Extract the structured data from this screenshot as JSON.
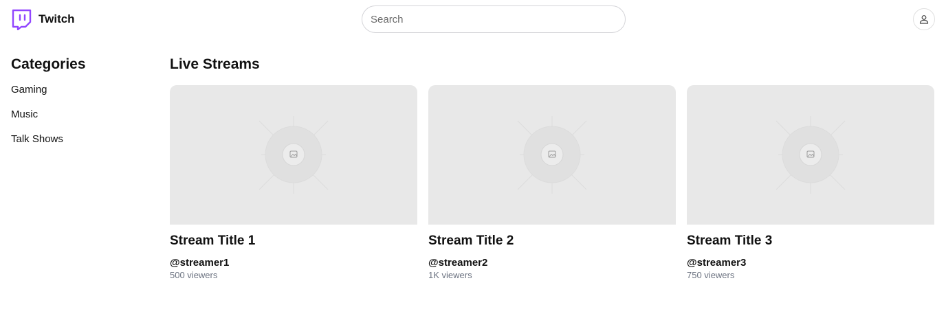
{
  "header": {
    "brand": "Twitch",
    "search_placeholder": "Search"
  },
  "sidebar": {
    "title": "Categories",
    "items": [
      {
        "label": "Gaming"
      },
      {
        "label": "Music"
      },
      {
        "label": "Talk Shows"
      }
    ]
  },
  "main": {
    "title": "Live Streams",
    "streams": [
      {
        "title": "Stream Title 1",
        "streamer": "@streamer1",
        "viewers": "500 viewers"
      },
      {
        "title": "Stream Title 2",
        "streamer": "@streamer2",
        "viewers": "1K viewers"
      },
      {
        "title": "Stream Title 3",
        "streamer": "@streamer3",
        "viewers": "750 viewers"
      }
    ]
  },
  "colors": {
    "brand": "#9146ff",
    "thumbnail_bg": "#e8e8e8",
    "muted_text": "#6b7280"
  },
  "icons": {
    "logo": "twitch-logo-icon",
    "avatar": "user-icon",
    "thumbnail": "image-placeholder-icon"
  }
}
